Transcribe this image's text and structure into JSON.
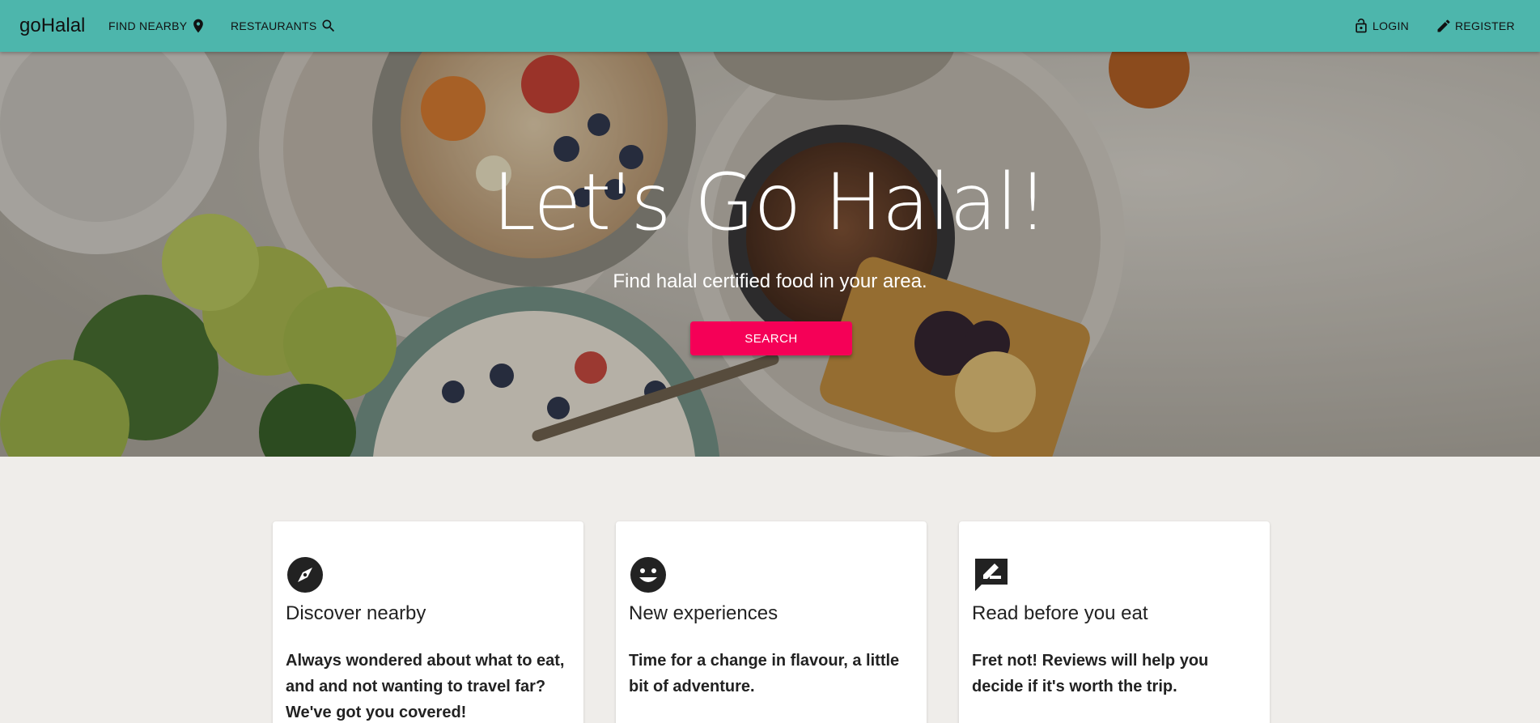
{
  "nav": {
    "brand": "goHalal",
    "find_nearby": "FIND NEARBY",
    "restaurants": "RESTAURANTS",
    "login": "LOGIN",
    "register": "REGISTER"
  },
  "hero": {
    "title": "Let's Go Halal!",
    "subtitle": "Find halal certified food in your area.",
    "button": "SEARCH"
  },
  "features": [
    {
      "icon": "compass-icon",
      "title": "Discover nearby",
      "text": "Always wondered about what to eat, and and not wanting to travel far? We've got you covered!"
    },
    {
      "icon": "smiley-icon",
      "title": "New experiences",
      "text": "Time for a change in flavour, a little bit of adventure."
    },
    {
      "icon": "review-icon",
      "title": "Read before you eat",
      "text": "Fret not! Reviews will help you decide if it's worth the trip."
    }
  ],
  "colors": {
    "appbar": "#4db6ac",
    "accent": "#f50057",
    "background": "#efedea"
  }
}
